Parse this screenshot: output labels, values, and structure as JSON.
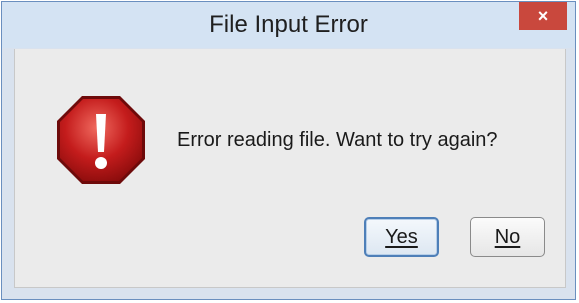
{
  "dialog": {
    "title": "File Input Error",
    "close_label": "×",
    "message": "Error reading file. Want to try again?",
    "icon": "error-icon",
    "buttons": {
      "yes_label": "Yes",
      "no_label": "No"
    }
  },
  "colors": {
    "title_bar": "#d4e3f3",
    "close_button": "#c9483d",
    "content_bg": "#ebebeb",
    "error_red": "#c41c1c",
    "focus_border": "#4e7fb8"
  }
}
